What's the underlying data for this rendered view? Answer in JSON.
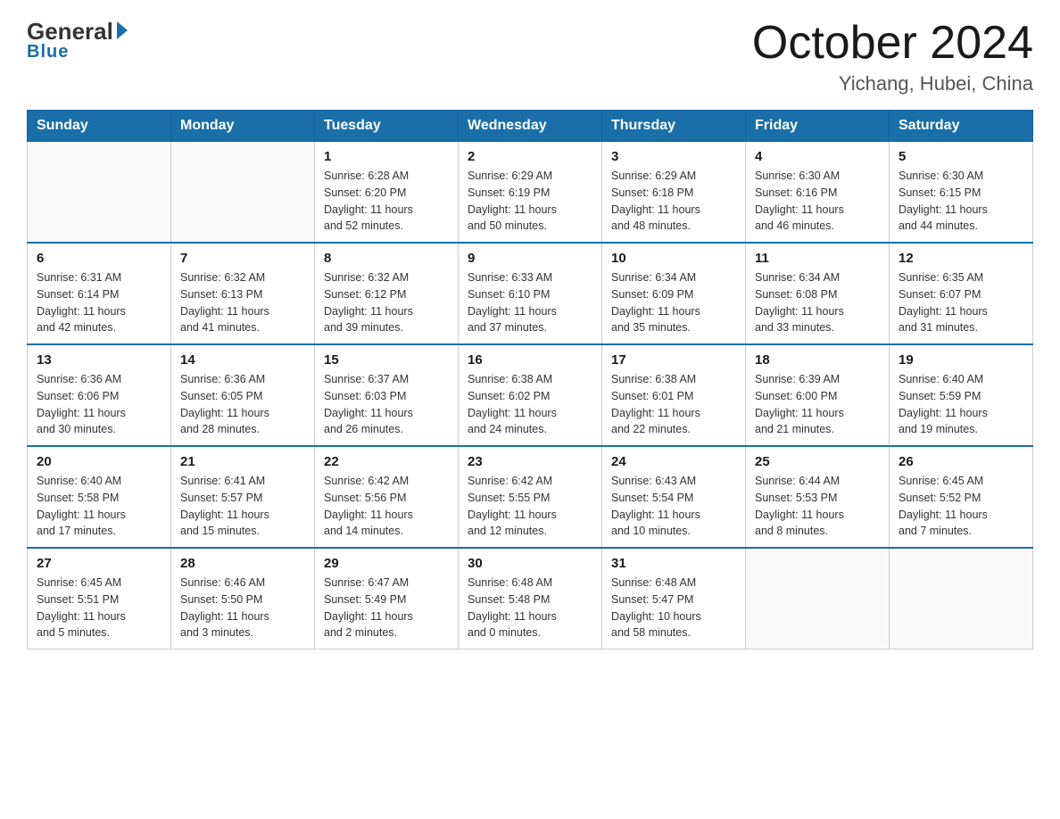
{
  "header": {
    "logo_general": "General",
    "logo_blue": "Blue",
    "month_title": "October 2024",
    "location": "Yichang, Hubei, China"
  },
  "weekdays": [
    "Sunday",
    "Monday",
    "Tuesday",
    "Wednesday",
    "Thursday",
    "Friday",
    "Saturday"
  ],
  "weeks": [
    [
      {
        "day": "",
        "info": ""
      },
      {
        "day": "",
        "info": ""
      },
      {
        "day": "1",
        "info": "Sunrise: 6:28 AM\nSunset: 6:20 PM\nDaylight: 11 hours\nand 52 minutes."
      },
      {
        "day": "2",
        "info": "Sunrise: 6:29 AM\nSunset: 6:19 PM\nDaylight: 11 hours\nand 50 minutes."
      },
      {
        "day": "3",
        "info": "Sunrise: 6:29 AM\nSunset: 6:18 PM\nDaylight: 11 hours\nand 48 minutes."
      },
      {
        "day": "4",
        "info": "Sunrise: 6:30 AM\nSunset: 6:16 PM\nDaylight: 11 hours\nand 46 minutes."
      },
      {
        "day": "5",
        "info": "Sunrise: 6:30 AM\nSunset: 6:15 PM\nDaylight: 11 hours\nand 44 minutes."
      }
    ],
    [
      {
        "day": "6",
        "info": "Sunrise: 6:31 AM\nSunset: 6:14 PM\nDaylight: 11 hours\nand 42 minutes."
      },
      {
        "day": "7",
        "info": "Sunrise: 6:32 AM\nSunset: 6:13 PM\nDaylight: 11 hours\nand 41 minutes."
      },
      {
        "day": "8",
        "info": "Sunrise: 6:32 AM\nSunset: 6:12 PM\nDaylight: 11 hours\nand 39 minutes."
      },
      {
        "day": "9",
        "info": "Sunrise: 6:33 AM\nSunset: 6:10 PM\nDaylight: 11 hours\nand 37 minutes."
      },
      {
        "day": "10",
        "info": "Sunrise: 6:34 AM\nSunset: 6:09 PM\nDaylight: 11 hours\nand 35 minutes."
      },
      {
        "day": "11",
        "info": "Sunrise: 6:34 AM\nSunset: 6:08 PM\nDaylight: 11 hours\nand 33 minutes."
      },
      {
        "day": "12",
        "info": "Sunrise: 6:35 AM\nSunset: 6:07 PM\nDaylight: 11 hours\nand 31 minutes."
      }
    ],
    [
      {
        "day": "13",
        "info": "Sunrise: 6:36 AM\nSunset: 6:06 PM\nDaylight: 11 hours\nand 30 minutes."
      },
      {
        "day": "14",
        "info": "Sunrise: 6:36 AM\nSunset: 6:05 PM\nDaylight: 11 hours\nand 28 minutes."
      },
      {
        "day": "15",
        "info": "Sunrise: 6:37 AM\nSunset: 6:03 PM\nDaylight: 11 hours\nand 26 minutes."
      },
      {
        "day": "16",
        "info": "Sunrise: 6:38 AM\nSunset: 6:02 PM\nDaylight: 11 hours\nand 24 minutes."
      },
      {
        "day": "17",
        "info": "Sunrise: 6:38 AM\nSunset: 6:01 PM\nDaylight: 11 hours\nand 22 minutes."
      },
      {
        "day": "18",
        "info": "Sunrise: 6:39 AM\nSunset: 6:00 PM\nDaylight: 11 hours\nand 21 minutes."
      },
      {
        "day": "19",
        "info": "Sunrise: 6:40 AM\nSunset: 5:59 PM\nDaylight: 11 hours\nand 19 minutes."
      }
    ],
    [
      {
        "day": "20",
        "info": "Sunrise: 6:40 AM\nSunset: 5:58 PM\nDaylight: 11 hours\nand 17 minutes."
      },
      {
        "day": "21",
        "info": "Sunrise: 6:41 AM\nSunset: 5:57 PM\nDaylight: 11 hours\nand 15 minutes."
      },
      {
        "day": "22",
        "info": "Sunrise: 6:42 AM\nSunset: 5:56 PM\nDaylight: 11 hours\nand 14 minutes."
      },
      {
        "day": "23",
        "info": "Sunrise: 6:42 AM\nSunset: 5:55 PM\nDaylight: 11 hours\nand 12 minutes."
      },
      {
        "day": "24",
        "info": "Sunrise: 6:43 AM\nSunset: 5:54 PM\nDaylight: 11 hours\nand 10 minutes."
      },
      {
        "day": "25",
        "info": "Sunrise: 6:44 AM\nSunset: 5:53 PM\nDaylight: 11 hours\nand 8 minutes."
      },
      {
        "day": "26",
        "info": "Sunrise: 6:45 AM\nSunset: 5:52 PM\nDaylight: 11 hours\nand 7 minutes."
      }
    ],
    [
      {
        "day": "27",
        "info": "Sunrise: 6:45 AM\nSunset: 5:51 PM\nDaylight: 11 hours\nand 5 minutes."
      },
      {
        "day": "28",
        "info": "Sunrise: 6:46 AM\nSunset: 5:50 PM\nDaylight: 11 hours\nand 3 minutes."
      },
      {
        "day": "29",
        "info": "Sunrise: 6:47 AM\nSunset: 5:49 PM\nDaylight: 11 hours\nand 2 minutes."
      },
      {
        "day": "30",
        "info": "Sunrise: 6:48 AM\nSunset: 5:48 PM\nDaylight: 11 hours\nand 0 minutes."
      },
      {
        "day": "31",
        "info": "Sunrise: 6:48 AM\nSunset: 5:47 PM\nDaylight: 10 hours\nand 58 minutes."
      },
      {
        "day": "",
        "info": ""
      },
      {
        "day": "",
        "info": ""
      }
    ]
  ]
}
